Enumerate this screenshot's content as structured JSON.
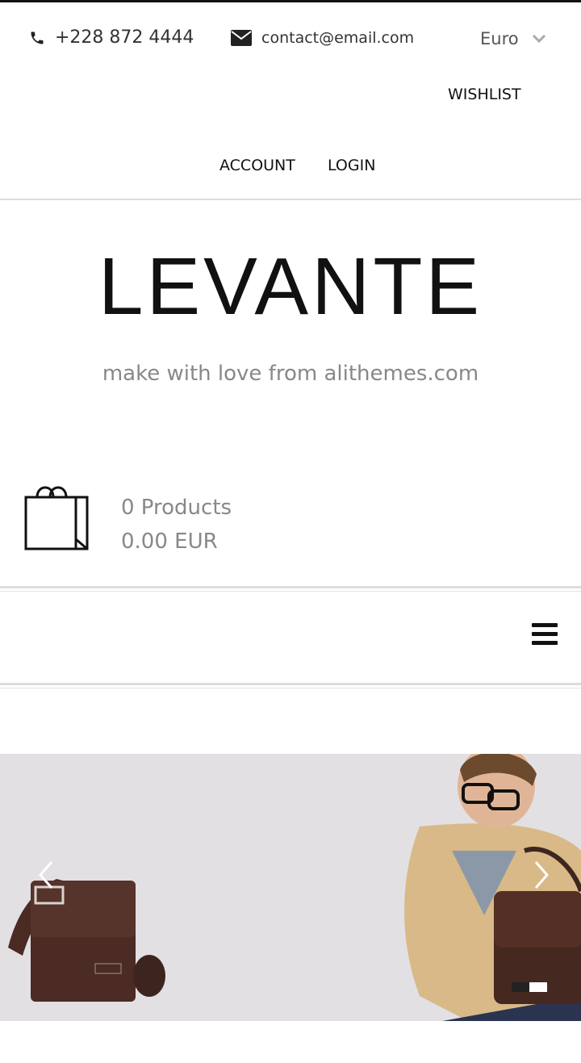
{
  "topbar": {
    "phone": "+228 872 4444",
    "email": "contact@email.com",
    "currency": "Euro"
  },
  "nav": {
    "wishlist": "WISHLIST",
    "account": "ACCOUNT",
    "login": "LOGIN"
  },
  "brand": {
    "logo": "LEVANTE",
    "tagline": "make with love from alithemes.com"
  },
  "cart": {
    "count": "0 Products",
    "total": "0.00 EUR"
  },
  "colors": {
    "slider_bg": "#e2e0e3",
    "bag_brown": "#4a2a22"
  },
  "slider": {
    "slide_count": 2,
    "active_index": 1
  }
}
